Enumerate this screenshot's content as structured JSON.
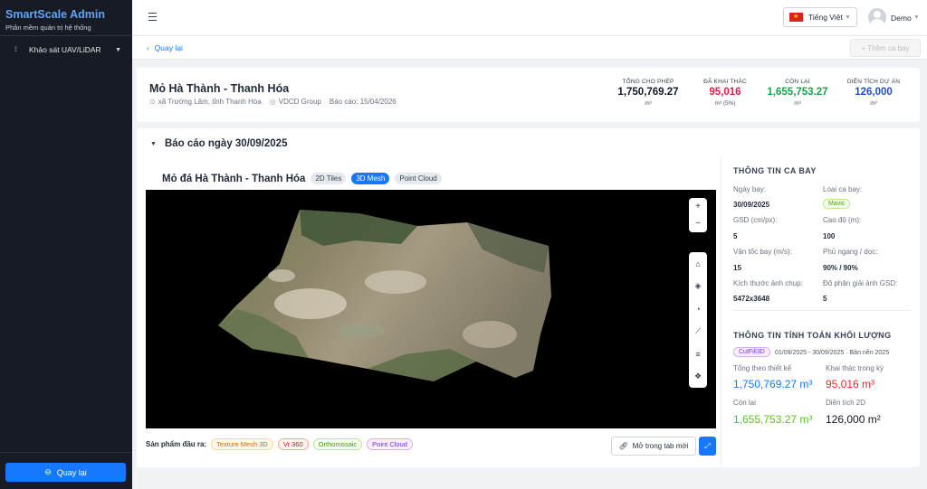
{
  "app": {
    "title": "SmartScale Admin",
    "subtitle": "Phần mềm quản trị hệ thống"
  },
  "sidebar": {
    "items": [
      {
        "icon": "drone-icon",
        "label": "Khảo sát UAV/LiDAR"
      }
    ],
    "footer_button": "Quay lại"
  },
  "header": {
    "language": "Tiếng Việt",
    "user": "Demo"
  },
  "toolbar": {
    "back_label": "Quay lại",
    "add_label": "+  Thêm ca bay"
  },
  "mine": {
    "title": "Mỏ Hà Thành - Thanh Hóa",
    "location": "xã Trường Lâm, tỉnh Thanh Hóa",
    "company": "VDCD Group",
    "report_date": "Báo cáo: 15/04/2026",
    "stats": [
      {
        "label": "Tổng cho phép",
        "value": "1,750,769.27",
        "unit": "m³",
        "color": "#111827"
      },
      {
        "label": "Đã khai thác",
        "value": "95,016",
        "unit": "m³ (5%)",
        "color": "#e11d48"
      },
      {
        "label": "Còn lại",
        "value": "1,655,753.27",
        "unit": "m³",
        "color": "#16a34a"
      },
      {
        "label": "Diện tích dự án",
        "value": "126,000",
        "unit": "m²",
        "color": "#1d4ed8"
      }
    ]
  },
  "report": {
    "heading": "Báo cáo ngày 30/09/2025",
    "viewer_title": "Mỏ đá Hà Thành - Thanh Hóa",
    "view_modes": [
      "2D Tiles",
      "3D Mesh",
      "Point Cloud"
    ],
    "active_mode": "3D Mesh",
    "outputs_label": "Sản phẩm đầu ra:",
    "outputs": [
      {
        "label": "Texture Mesh 3D",
        "color": "#d46b08",
        "bg": "#fff7e6",
        "border": "#ffd591"
      },
      {
        "label": "Vr 360",
        "color": "#cf1322",
        "bg": "#fff1f0",
        "border": "#ffa39e"
      },
      {
        "label": "Orthomosaic",
        "color": "#389e0d",
        "bg": "#f6ffed",
        "border": "#b7eb8f"
      },
      {
        "label": "Point Cloud",
        "color": "#722ed1",
        "bg": "#f9f0ff",
        "border": "#d3adf7"
      }
    ],
    "open_new_tab": "Mở trong tab mới",
    "viewer_controls": [
      "zoom-in-icon",
      "zoom-out-icon",
      "home-icon",
      "layers-icon",
      "gauge-icon",
      "measure-icon",
      "list-icon",
      "stack-icon"
    ]
  },
  "flight_info": {
    "heading": "THÔNG TIN CA BAY",
    "fields": [
      {
        "label": "Ngày bay:",
        "value": "30/09/2025"
      },
      {
        "label": "Loại ca bay:",
        "value": "Mavic"
      },
      {
        "label": "GSD (cm/px):",
        "value": "5"
      },
      {
        "label": "Cao độ (m):",
        "value": "100"
      },
      {
        "label": "Vận tốc bay (m/s):",
        "value": "15"
      },
      {
        "label": "Phủ ngang / dọc:",
        "value": "90% / 90%"
      },
      {
        "label": "Kích thước ảnh chụp:",
        "value": "5472x3648"
      },
      {
        "label": "Độ phân giải ảnh GSD:",
        "value": "5"
      }
    ]
  },
  "volume_info": {
    "heading": "THÔNG TIN TÍNH TOÁN KHỐI LƯỢNG",
    "method": "CutFill3D",
    "range": "01/09/2025 - 30/09/2025 · Bản nền 2025",
    "metrics": [
      {
        "label": "Tổng theo thiết kế",
        "value": "1,750,769.27 m³",
        "color": "#1677ff"
      },
      {
        "label": "Khai thác trong kỳ",
        "value": "95,016 m³",
        "color": "#f5222d"
      },
      {
        "label": "Còn lại",
        "value": "1,655,753.27 m³",
        "color": "#52c41a"
      },
      {
        "label": "Diện tích 2D",
        "value": "126,000 m²",
        "color": "#111827"
      }
    ]
  }
}
